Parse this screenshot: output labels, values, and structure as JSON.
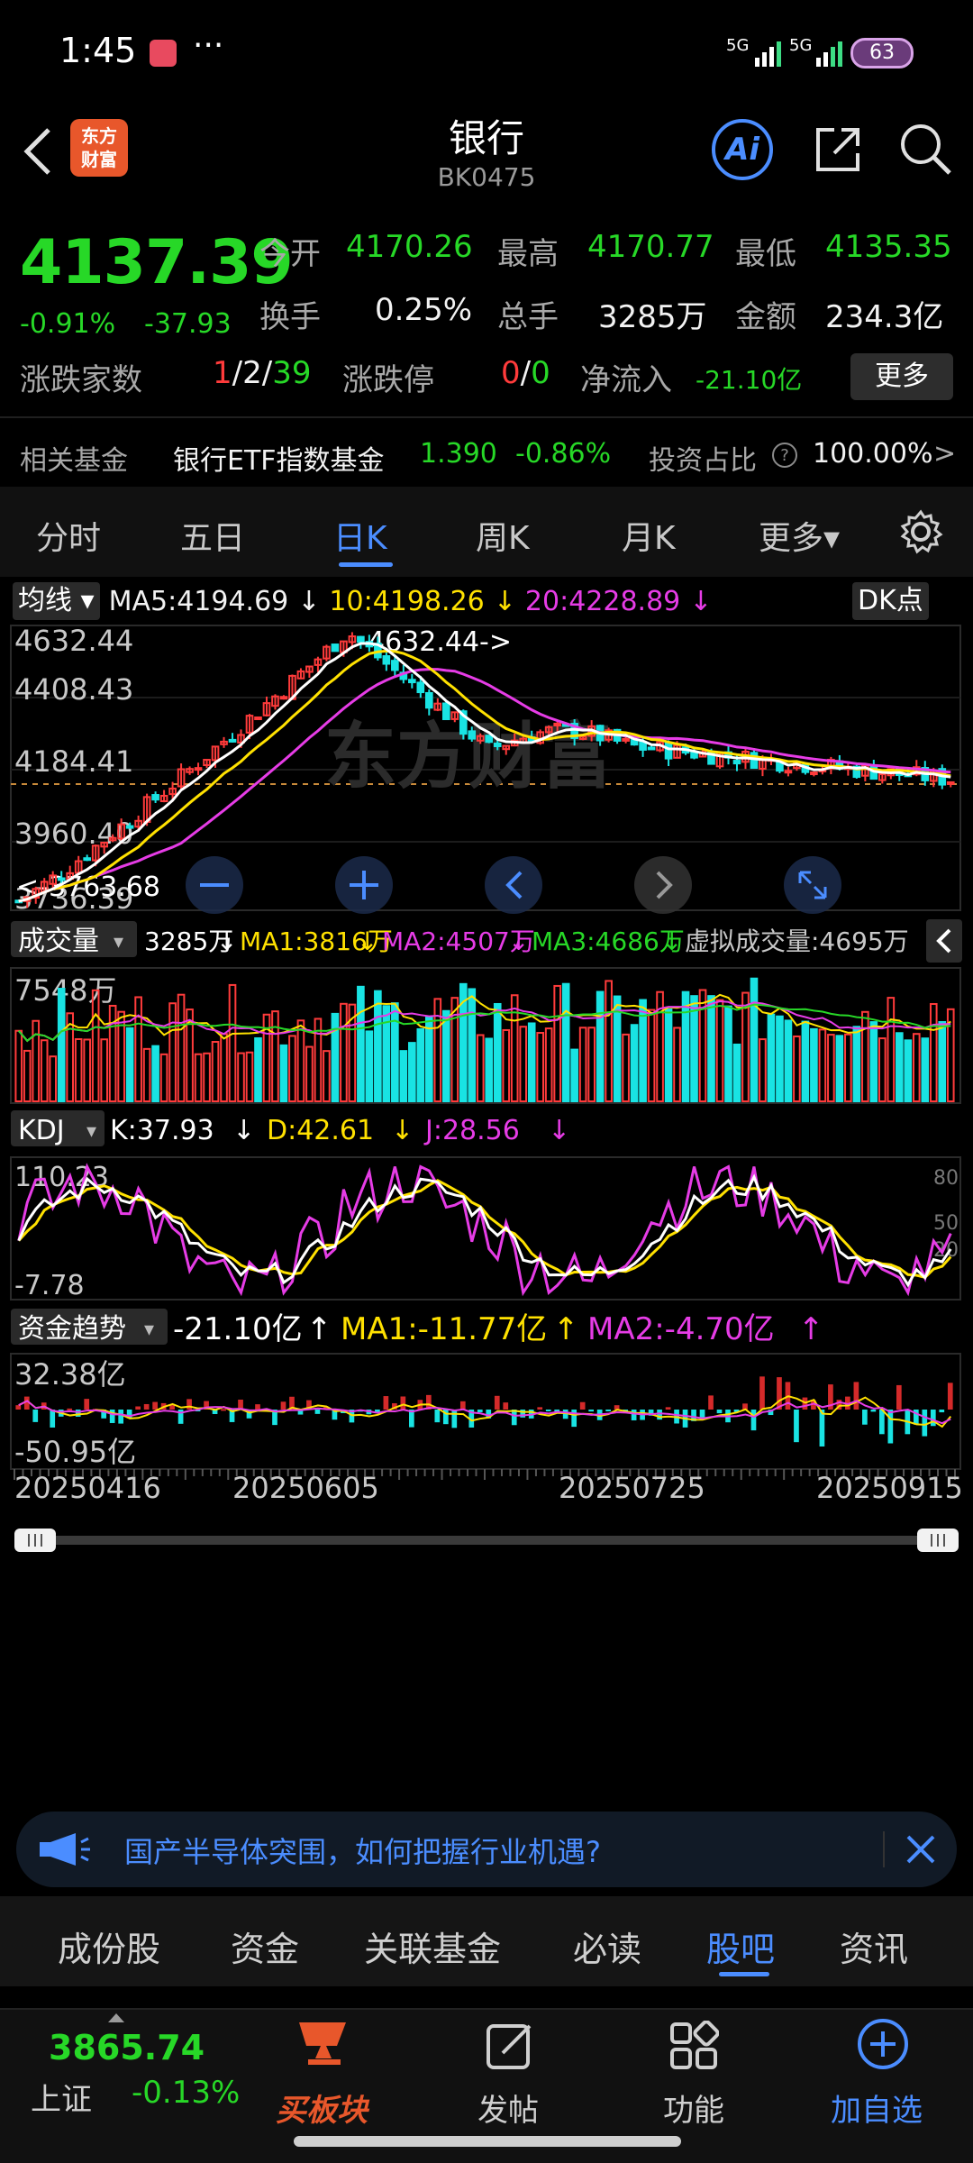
{
  "status_bar": {
    "time": "1:45",
    "dots": "···",
    "sig1": "5G",
    "sig2": "5G",
    "battery": "63"
  },
  "header": {
    "title": "银行",
    "code": "BK0475",
    "logo_line1": "东方",
    "logo_line2": "财富",
    "ai_label": "Ai"
  },
  "quote": {
    "price": "4137.39",
    "change_pct": "-0.91%",
    "change_abs": "-37.93",
    "open_label": "今开",
    "open": "4170.26",
    "high_label": "最高",
    "high": "4170.77",
    "low_label": "最低",
    "low": "4135.35",
    "turnover_label": "换手",
    "turnover": "0.25%",
    "volume_label": "总手",
    "volume": "3285万",
    "amount_label": "金额",
    "amount": "234.3亿",
    "breadth_label": "涨跌家数",
    "breadth_up": "1",
    "breadth_sep1": "/",
    "breadth_flat": "2",
    "breadth_sep2": "/",
    "breadth_down": "39",
    "limit_label": "涨跌停",
    "limit_up": "0",
    "limit_sep": "/",
    "limit_down": "0",
    "netflow_label": "净流入",
    "netflow": "-21.10亿",
    "more": "更多"
  },
  "fund": {
    "label": "相关基金",
    "name": "银行ETF指数基金",
    "price": "1.390",
    "change": "-0.86%",
    "ratio_label": "投资占比",
    "ratio": "100.00%",
    "arrow": ">"
  },
  "period_tabs": [
    {
      "label": "分时"
    },
    {
      "label": "五日"
    },
    {
      "label": "日K"
    },
    {
      "label": "周K"
    },
    {
      "label": "月K"
    },
    {
      "label": "更多▾"
    }
  ],
  "ma_line": {
    "btn": "均线",
    "ma5": "MA5:4194.69",
    "ma5_arrow": "↓",
    "ma10": "10:4198.26",
    "ma10_arrow": "↓",
    "ma20": "20:4228.89",
    "ma20_arrow": "↓",
    "dk": "DK点"
  },
  "price_axis": {
    "p1": "4632.44",
    "p2": "4408.43",
    "p3": "4184.41",
    "p4": "3960.40",
    "p5": "3736.39",
    "max_label": "4632.44->",
    "min_label": "<-3763.68"
  },
  "volume_line": {
    "btn": "成交量",
    "vol": "3285万",
    "vol_arrow": "↓",
    "ma1": "MA1:3816万",
    "ma1_arrow": "↓",
    "ma2": "MA2:4507万",
    "ma2_arrow": "↓",
    "ma3": "MA3:4686万",
    "ma3_arrow": "↓",
    "virtual": "虚拟成交量:4695万",
    "axis_top": "7548万"
  },
  "kdj_line": {
    "btn": "KDJ",
    "k": "K:37.93",
    "k_arrow": "↓",
    "d": "D:42.61",
    "d_arrow": "↓",
    "j": "J:28.56",
    "j_arrow": "↓",
    "axis_top": "110.23",
    "axis_bottom": "-7.78",
    "ref80": "80",
    "ref50": "50",
    "ref20": "20"
  },
  "fund_flow_line": {
    "btn": "资金趋势",
    "val": "-21.10亿",
    "val_arrow": "↑",
    "ma1": "MA1:-11.77亿",
    "ma1_arrow": "↑",
    "ma2": "MA2:-4.70亿",
    "ma2_arrow": "↑",
    "axis_top": "32.38亿",
    "axis_bottom": "-50.95亿"
  },
  "date_axis": {
    "d1": "20250416",
    "d2": "20250605",
    "d3": "20250725",
    "d4": "20250915"
  },
  "banner": {
    "text": "国产半导体突围，如何把握行业机遇?"
  },
  "sub_tabs": [
    {
      "label": "成份股"
    },
    {
      "label": "资金"
    },
    {
      "label": "关联基金"
    },
    {
      "label": "必读"
    },
    {
      "label": "股吧"
    },
    {
      "label": "资讯"
    }
  ],
  "bottom_nav": {
    "index_value": "3865.74",
    "index_name": "上证",
    "index_change": "-0.13%",
    "buy_sector": "买板块",
    "post": "发帖",
    "features": "功能",
    "add_watch": "加自选"
  },
  "colors": {
    "up": "#ff3b3b",
    "down": "#27d827",
    "accent": "#4b8dff",
    "ma5": "#ffffff",
    "ma10": "#ffe100",
    "ma20": "#e63ce6",
    "candle_down": "#19e3e3"
  }
}
